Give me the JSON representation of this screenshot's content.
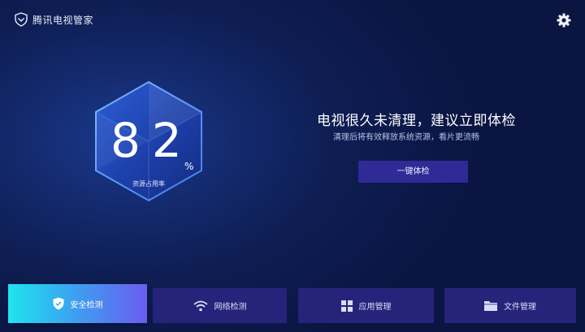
{
  "app": {
    "title": "腾讯电视管家"
  },
  "score": {
    "value": "82",
    "unit": "%",
    "label": "资源占用率"
  },
  "main": {
    "headline": "电视很久未清理，建议立即体检",
    "subline": "清理后将有效释放系统资源，看片更流畅",
    "scan_button": "一键体检"
  },
  "tabs": [
    {
      "label": "安全检测",
      "icon": "shield-icon",
      "active": true
    },
    {
      "label": "网络检测",
      "icon": "wifi-icon",
      "active": false
    },
    {
      "label": "应用管理",
      "icon": "grid-icon",
      "active": false
    },
    {
      "label": "文件管理",
      "icon": "folder-icon",
      "active": false
    }
  ],
  "colors": {
    "accent": "#2e2b96",
    "tab_bg": "#26237a",
    "active_gradient_start": "#1fe4ee",
    "active_gradient_end": "#6a5cf0"
  }
}
